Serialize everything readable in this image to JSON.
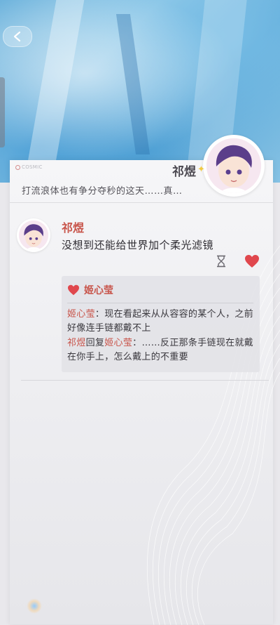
{
  "header": {
    "logo_text": "COSMIC",
    "name": "祁煜",
    "preview": "打流浪体也有争分夺秒的这天……真…"
  },
  "post": {
    "author": "祁煜",
    "text": "没想到还能给世界加个柔光滤镜"
  },
  "likes": {
    "name": "姬心莹"
  },
  "comments": [
    {
      "author": "姬心莹",
      "separator": "：",
      "text": "现在看起来从从容容的某个人，之前好像连手链都戴不上"
    },
    {
      "author": "祁煜",
      "reply_word": "回复",
      "reply_to": "姬心莹",
      "separator": "：",
      "text": "……反正那条手链现在就戴在你手上，怎么戴上的不重要"
    }
  ],
  "icons": {
    "back": "chevron-left-icon",
    "hourglass": "hourglass-icon",
    "heart": "heart-icon"
  },
  "colors": {
    "accent": "#c8544a",
    "heart": "#e0474d"
  }
}
